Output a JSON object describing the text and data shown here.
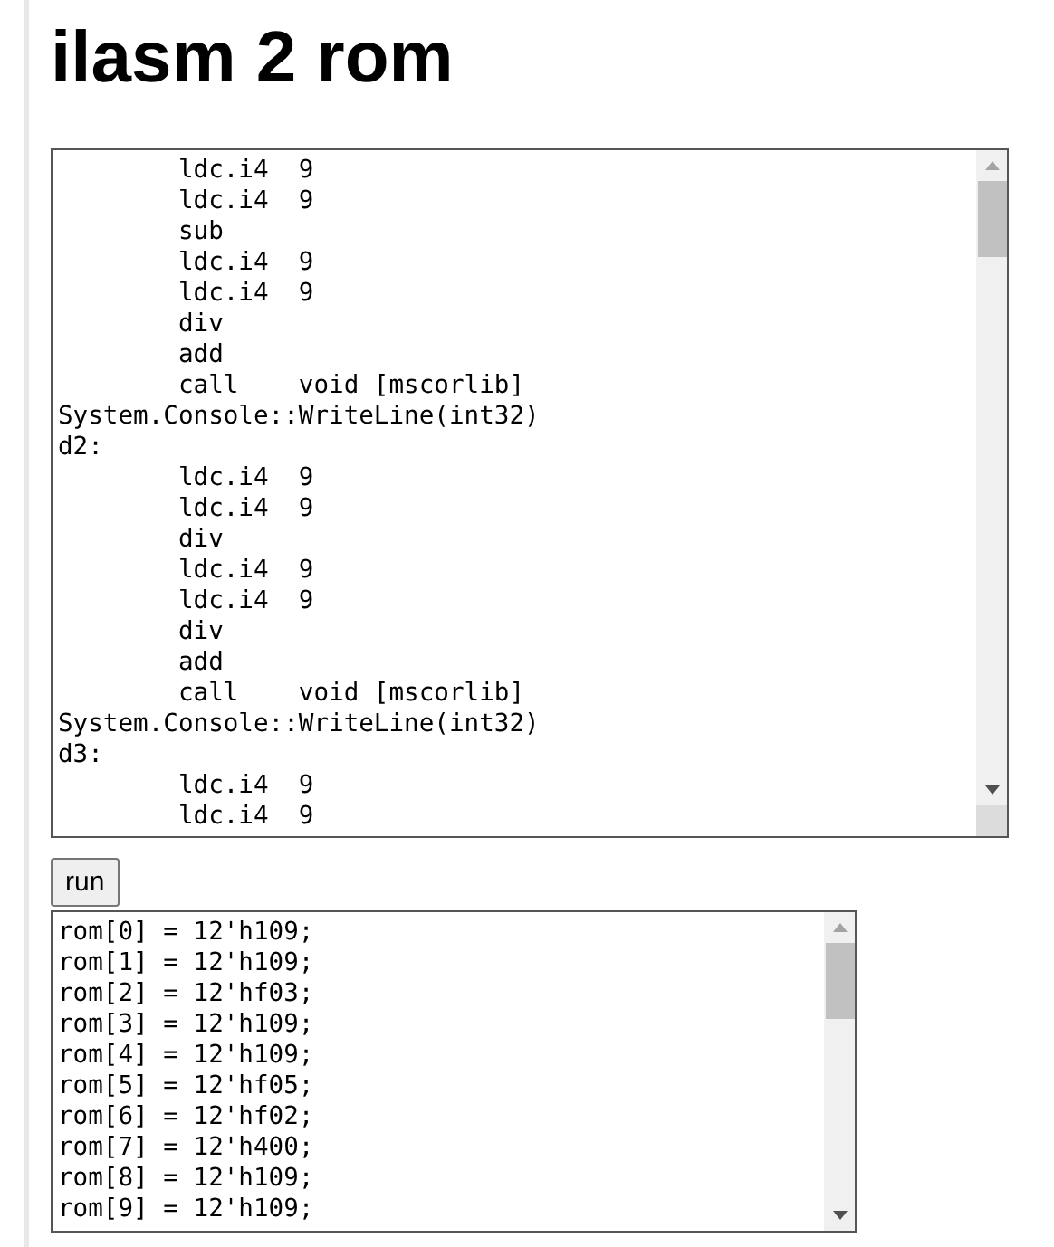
{
  "title": "ilasm 2 rom",
  "code_editor": {
    "lines": [
      "        ldc.i4  9",
      "        ldc.i4  9",
      "        sub",
      "        ldc.i4  9",
      "        ldc.i4  9",
      "        div",
      "        add",
      "        call    void [mscorlib]",
      "System.Console::WriteLine(int32)",
      "d2:",
      "        ldc.i4  9",
      "        ldc.i4  9",
      "        div",
      "        ldc.i4  9",
      "        ldc.i4  9",
      "        div",
      "        add",
      "        call    void [mscorlib]",
      "System.Console::WriteLine(int32)",
      "d3:",
      "        ldc.i4  9",
      "        ldc.i4  9"
    ]
  },
  "run_button": {
    "label": "run"
  },
  "output": {
    "lines": [
      "rom[0] = 12'h109;",
      "rom[1] = 12'h109;",
      "rom[2] = 12'hf03;",
      "rom[3] = 12'h109;",
      "rom[4] = 12'h109;",
      "rom[5] = 12'hf05;",
      "rom[6] = 12'hf02;",
      "rom[7] = 12'h400;",
      "rom[8] = 12'h109;",
      "rom[9] = 12'h109;"
    ]
  }
}
